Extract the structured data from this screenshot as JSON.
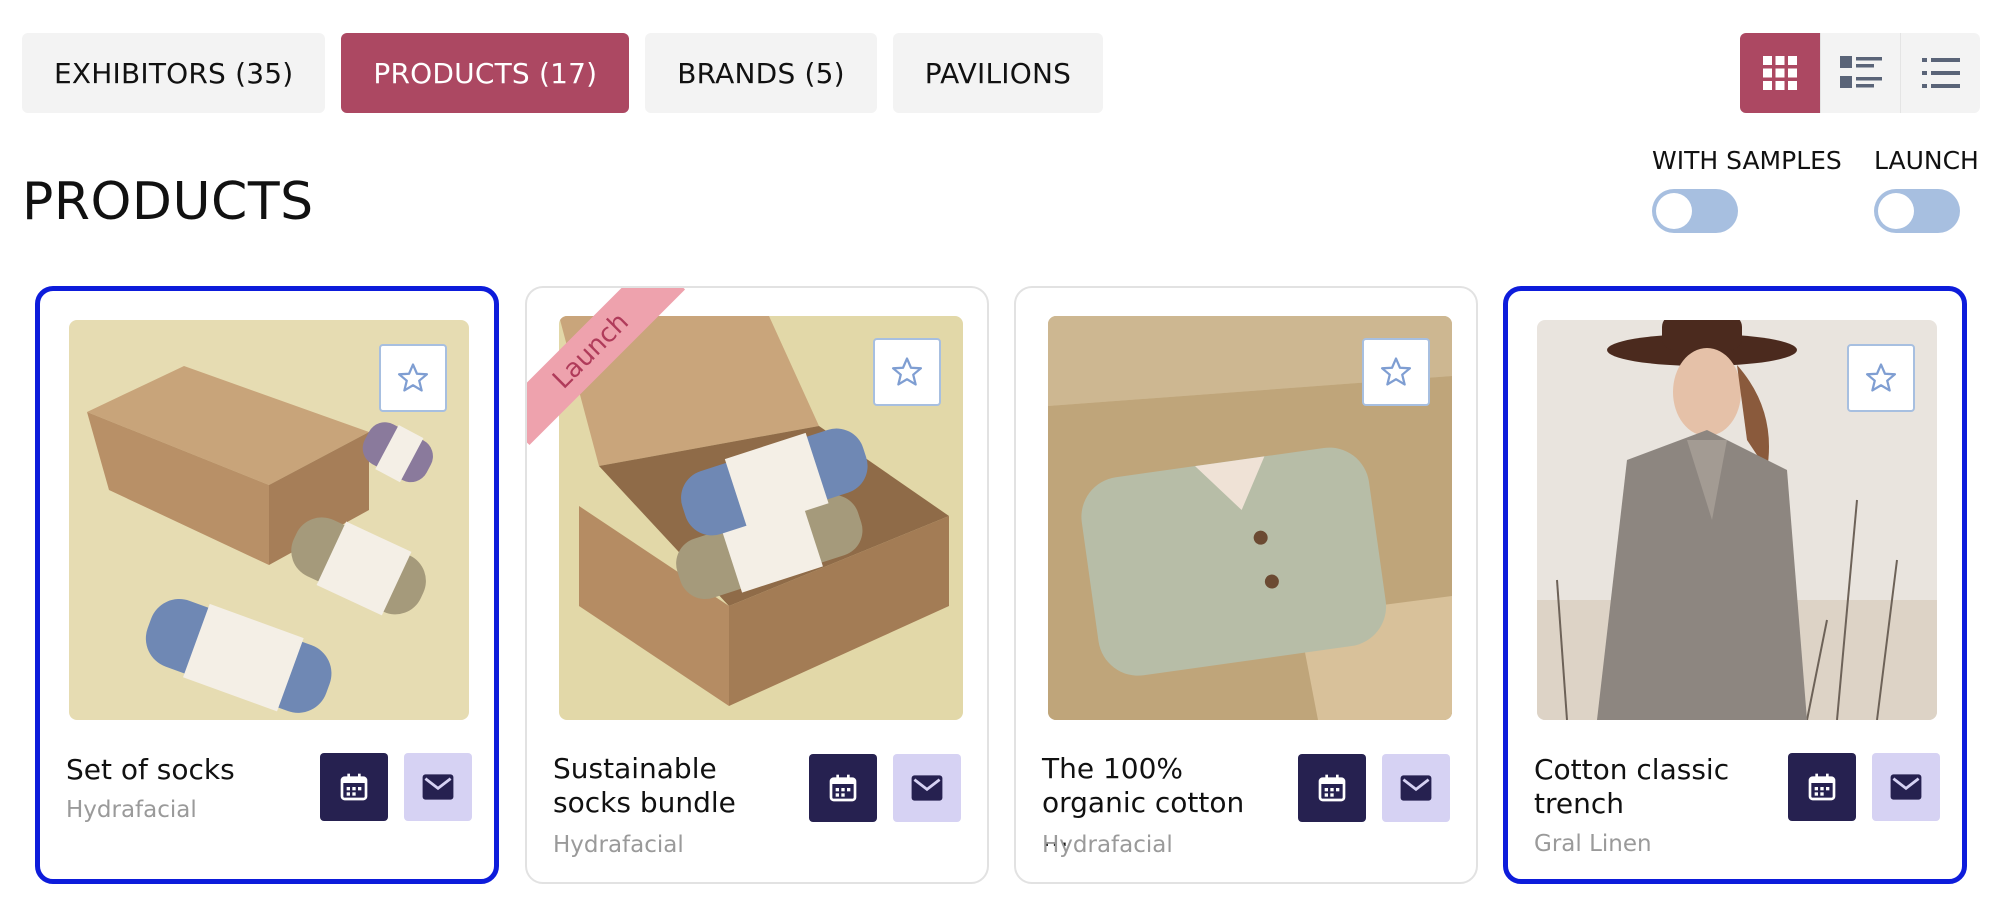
{
  "tabs": [
    {
      "label": "EXHIBITORS (35)",
      "active": false
    },
    {
      "label": "PRODUCTS (17)",
      "active": true
    },
    {
      "label": "BRANDS (5)",
      "active": false
    },
    {
      "label": "PAVILIONS",
      "active": false
    }
  ],
  "view_modes": [
    {
      "icon": "grid-view-icon",
      "active": true
    },
    {
      "icon": "detailed-list-view-icon",
      "active": false
    },
    {
      "icon": "list-view-icon",
      "active": false
    }
  ],
  "page_title": "PRODUCTS",
  "filters": {
    "with_samples": {
      "label": "WITH SAMPLES",
      "on": false
    },
    "launch": {
      "label": "LAUNCH",
      "on": false
    }
  },
  "products": [
    {
      "title": "Set of socks",
      "brand": "Hydrafacial",
      "selected": true,
      "ribbon": ""
    },
    {
      "title": "Sustainable socks bundle",
      "brand": "Hydrafacial",
      "selected": false,
      "ribbon": "Launch"
    },
    {
      "title": "The 100% organic cotton ...",
      "brand": "Hydrafacial",
      "selected": false,
      "ribbon": ""
    },
    {
      "title": "Cotton classic trench",
      "brand": "Gral Linen",
      "selected": true,
      "ribbon": ""
    }
  ],
  "colors": {
    "accent": "#ac4862",
    "selected_border": "#0d1cdb",
    "calendar_button": "#262150",
    "mail_button": "#d6d2f3",
    "toggle_off": "#a7bfe0",
    "ribbon": "#eea2ad"
  }
}
